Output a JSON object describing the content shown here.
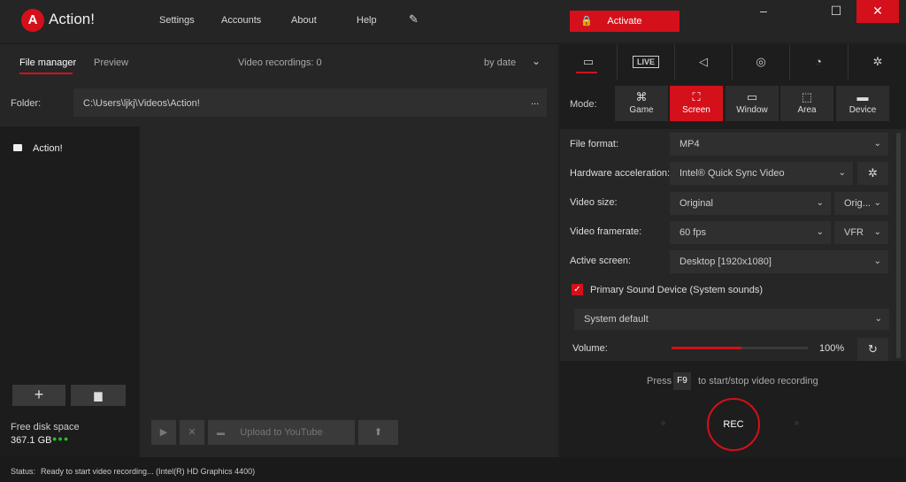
{
  "app": {
    "logo_text": "A",
    "name": "Action!"
  },
  "topnav": {
    "settings": "Settings",
    "accounts": "Accounts",
    "about": "About",
    "help": "Help",
    "brush_icon": "pen-icon"
  },
  "activate": {
    "label": "Activate",
    "icon": "lock-icon"
  },
  "window_controls": {
    "minimize": "–",
    "maximize": "☐",
    "close": "✕"
  },
  "left": {
    "tabs": {
      "file_manager": "File manager",
      "preview": "Preview"
    },
    "video_count": "Video recordings: 0",
    "sort": "by date",
    "folder_label": "Folder:",
    "folder_path": "C:\\Users\\ljkj\\Videos\\Action!",
    "folder_more": "...",
    "tree_root": "Action!",
    "add_button": "+",
    "free_disk_label": "Free disk space",
    "free_disk_value": "367.1 GB",
    "disk_dots": "●●●",
    "toolbar": {
      "play": "▶",
      "delete": "✕",
      "youtube_icon": "▬",
      "upload_youtube": "Upload to YouTube",
      "upload": "⬆"
    }
  },
  "right": {
    "tabs": [
      {
        "icon": "film-icon",
        "glyph": "▭"
      },
      {
        "icon": "live-icon",
        "glyph": "LIVE"
      },
      {
        "icon": "speaker-icon",
        "glyph": "◁"
      },
      {
        "icon": "camera-icon",
        "glyph": "◎"
      },
      {
        "icon": "timer-icon",
        "glyph": "◔"
      },
      {
        "icon": "gear-icon",
        "glyph": "✲"
      }
    ],
    "mode_label": "Mode:",
    "modes": [
      {
        "label": "Game",
        "glyph": "⌘"
      },
      {
        "label": "Screen",
        "glyph": "⛶"
      },
      {
        "label": "Window",
        "glyph": "▭"
      },
      {
        "label": "Area",
        "glyph": "⬚"
      },
      {
        "label": "Device",
        "glyph": "▬"
      }
    ],
    "active_mode": "Screen",
    "file_format": {
      "label": "File format:",
      "value": "MP4"
    },
    "hw_accel": {
      "label": "Hardware acceleration:",
      "value": "Intel® Quick Sync Video"
    },
    "video_size": {
      "label": "Video size:",
      "value": "Original",
      "value2": "Orig..."
    },
    "framerate": {
      "label": "Video framerate:",
      "value": "60 fps",
      "value2": "VFR"
    },
    "active_screen": {
      "label": "Active screen:",
      "value": "Desktop [1920x1080]"
    },
    "sound": {
      "checked": true,
      "label": "Primary Sound Device (System sounds)",
      "device": "System default"
    },
    "volume": {
      "label": "Volume:",
      "percent": 100,
      "display": "100%"
    },
    "press_pre": "Press",
    "hotkey": "F9",
    "press_post": "to start/stop video recording",
    "rec_label": "REC"
  },
  "status": {
    "label": "Status:",
    "text": "Ready to start video recording... (Intel(R) HD Graphics 4400)"
  },
  "colors": {
    "accent": "#d4101b",
    "background": "#1f1f1f",
    "panel": "#262626",
    "disk_ok": "#28c028"
  }
}
